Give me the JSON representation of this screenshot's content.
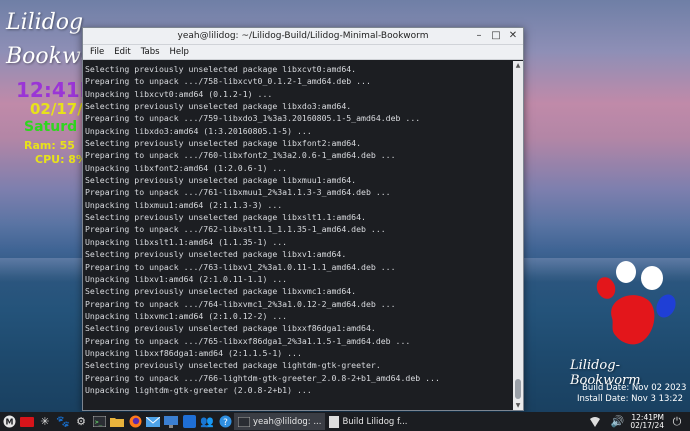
{
  "desktop": {
    "brand_top_line1": "Lilidog",
    "brand_top_line2": "Bookwo",
    "clock": "12:41P",
    "date": "02/17/",
    "day": "Saturd",
    "ram": "Ram:  55",
    "cpu": "CPU: 8%",
    "brand_bottom": "Lilidog-Bookworm",
    "build_date": "Build Date: Nov 02 2023",
    "install_date": "Install Date: Nov  3 13:22",
    "paw_colors": [
      "#e3161b",
      "#1f3fd6",
      "#ffffff"
    ]
  },
  "window": {
    "title": "yeah@lilidog: ~/Lilidog-Build/Lilidog-Minimal-Bookworm",
    "menu": [
      "File",
      "Edit",
      "Tabs",
      "Help"
    ],
    "lines": [
      "Selecting previously unselected package libxcvt0:amd64.",
      "Preparing to unpack .../758-libxcvt0_0.1.2-1_amd64.deb ...",
      "Unpacking libxcvt0:amd64 (0.1.2-1) ...",
      "Selecting previously unselected package libxdo3:amd64.",
      "Preparing to unpack .../759-libxdo3_1%3a3.20160805.1-5_amd64.deb ...",
      "Unpacking libxdo3:amd64 (1:3.20160805.1-5) ...",
      "Selecting previously unselected package libxfont2:amd64.",
      "Preparing to unpack .../760-libxfont2_1%3a2.0.6-1_amd64.deb ...",
      "Unpacking libxfont2:amd64 (1:2.0.6-1) ...",
      "Selecting previously unselected package libxmuu1:amd64.",
      "Preparing to unpack .../761-libxmuu1_2%3a1.1.3-3_amd64.deb ...",
      "Unpacking libxmuu1:amd64 (2:1.1.3-3) ...",
      "Selecting previously unselected package libxslt1.1:amd64.",
      "Preparing to unpack .../762-libxslt1.1_1.1.35-1_amd64.deb ...",
      "Unpacking libxslt1.1:amd64 (1.1.35-1) ...",
      "Selecting previously unselected package libxv1:amd64.",
      "Preparing to unpack .../763-libxv1_2%3a1.0.11-1.1_amd64.deb ...",
      "Unpacking libxv1:amd64 (2:1.0.11-1.1) ...",
      "Selecting previously unselected package libxvmc1:amd64.",
      "Preparing to unpack .../764-libxvmc1_2%3a1.0.12-2_amd64.deb ...",
      "Unpacking libxvmc1:amd64 (2:1.0.12-2) ...",
      "Selecting previously unselected package libxxf86dga1:amd64.",
      "Preparing to unpack .../765-libxxf86dga1_2%3a1.1.5-1_amd64.deb ...",
      "Unpacking libxxf86dga1:amd64 (2:1.1.5-1) ...",
      "Selecting previously unselected package lightdm-gtk-greeter.",
      "Preparing to unpack .../766-lightdm-gtk-greeter_2.0.8-2+b1_amd64.deb ...",
      "Unpacking lightdm-gtk-greeter (2.0.8-2+b1) ..."
    ]
  },
  "taskbar": {
    "launchers": [
      "menu-icon",
      "red-app-icon",
      "asterisk-icon",
      "paw-icon",
      "gear-icon",
      "terminal-icon",
      "folder-icon",
      "firefox-icon",
      "mail-icon",
      "monitor-icon",
      "blue-app-icon",
      "people-icon",
      "help-icon"
    ],
    "task_terminal": "yeah@lilidog: ...",
    "task_build": "Build Lilidog f...",
    "clock_time": "12:41PM",
    "clock_date": "02/17/24"
  }
}
